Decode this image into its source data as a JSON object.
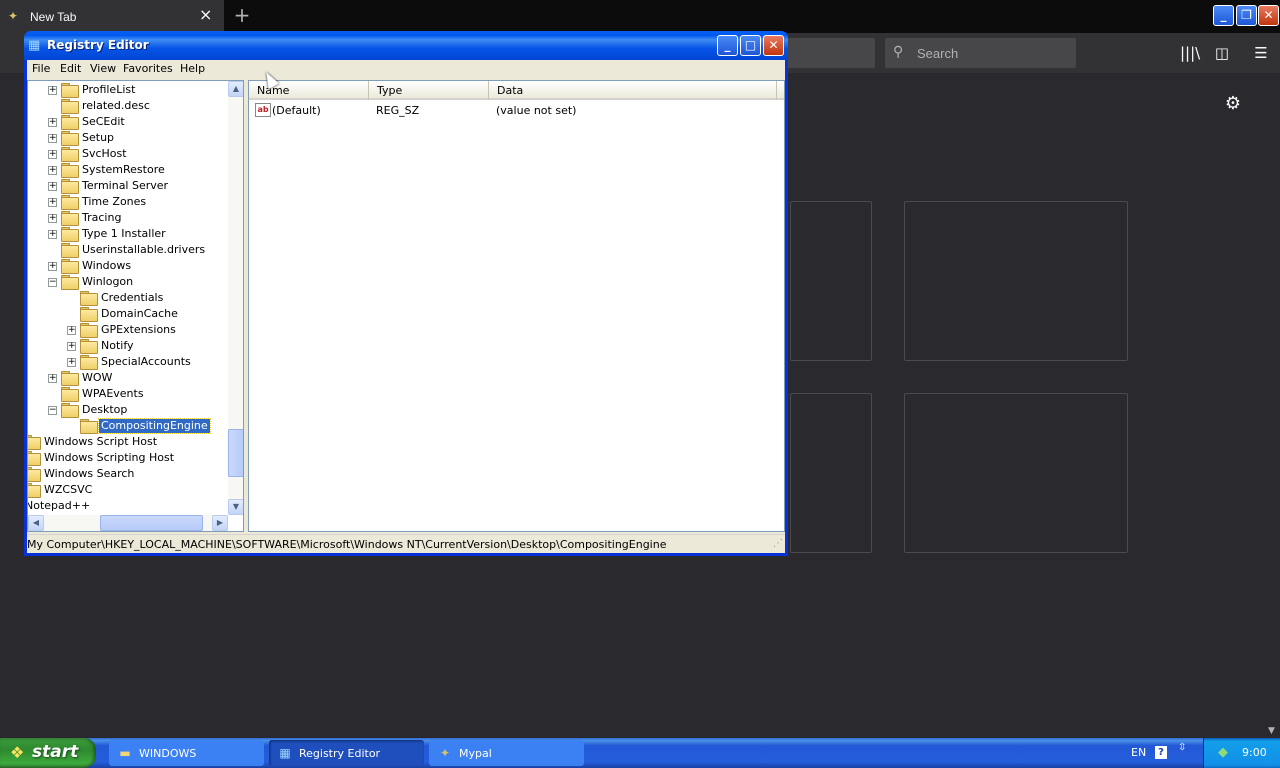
{
  "firefox": {
    "tab_title": "New Tab",
    "tab_close": "×",
    "new_tab": "+",
    "search_placeholder": "Search",
    "gear": "⚙",
    "library": "|||\\",
    "sidebar": "◫",
    "menu": "☰"
  },
  "regedit": {
    "title": "Registry Editor",
    "menu": [
      "File",
      "Edit",
      "View",
      "Favorites",
      "Help"
    ],
    "tree": [
      {
        "label": "ProfileList",
        "exp": "+",
        "level": 2
      },
      {
        "label": "related.desc",
        "exp": "",
        "level": 2
      },
      {
        "label": "SeCEdit",
        "exp": "+",
        "level": 2
      },
      {
        "label": "Setup",
        "exp": "+",
        "level": 2
      },
      {
        "label": "SvcHost",
        "exp": "+",
        "level": 2
      },
      {
        "label": "SystemRestore",
        "exp": "+",
        "level": 2
      },
      {
        "label": "Terminal Server",
        "exp": "+",
        "level": 2
      },
      {
        "label": "Time Zones",
        "exp": "+",
        "level": 2
      },
      {
        "label": "Tracing",
        "exp": "+",
        "level": 2
      },
      {
        "label": "Type 1 Installer",
        "exp": "+",
        "level": 2
      },
      {
        "label": "Userinstallable.drivers",
        "exp": "",
        "level": 2
      },
      {
        "label": "Windows",
        "exp": "+",
        "level": 2
      },
      {
        "label": "Winlogon",
        "exp": "−",
        "level": 2
      },
      {
        "label": "Credentials",
        "exp": "",
        "level": 3
      },
      {
        "label": "DomainCache",
        "exp": "",
        "level": 3
      },
      {
        "label": "GPExtensions",
        "exp": "+",
        "level": 3
      },
      {
        "label": "Notify",
        "exp": "+",
        "level": 3
      },
      {
        "label": "SpecialAccounts",
        "exp": "+",
        "level": 3
      },
      {
        "label": "WOW",
        "exp": "+",
        "level": 2
      },
      {
        "label": "WPAEvents",
        "exp": "",
        "level": 2
      },
      {
        "label": "Desktop",
        "exp": "−",
        "level": 2
      },
      {
        "label": "CompositingEngine",
        "exp": "",
        "level": 3,
        "selected": true
      },
      {
        "label": "Windows Script Host",
        "exp": "",
        "level": 0
      },
      {
        "label": "Windows Scripting Host",
        "exp": "",
        "level": 0
      },
      {
        "label": "Windows Search",
        "exp": "",
        "level": 0
      },
      {
        "label": "WZCSVC",
        "exp": "",
        "level": 0
      },
      {
        "label": "Notepad++",
        "exp": "",
        "level": -1
      }
    ],
    "columns": [
      "Name",
      "Type",
      "Data"
    ],
    "values": [
      {
        "name": "(Default)",
        "type": "REG_SZ",
        "data": "(value not set)",
        "icon": "ab"
      }
    ],
    "status": "My Computer\\HKEY_LOCAL_MACHINE\\SOFTWARE\\Microsoft\\Windows NT\\CurrentVersion\\Desktop\\CompositingEngine"
  },
  "taskbar": {
    "start": "start",
    "tasks": [
      {
        "label": "WINDOWS",
        "icon": "folder-icon",
        "active": false
      },
      {
        "label": "Registry Editor",
        "icon": "regedit-icon",
        "active": true
      },
      {
        "label": "Mypal",
        "icon": "mypal-icon",
        "active": false
      }
    ],
    "lang": "EN",
    "help": "?",
    "clock": "9:00"
  }
}
